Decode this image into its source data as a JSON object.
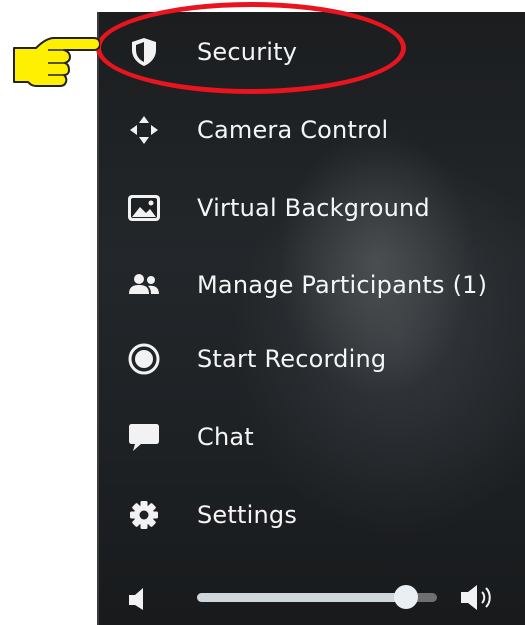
{
  "menu": {
    "items": [
      {
        "label": "Security",
        "icon": "shield-icon"
      },
      {
        "label": "Camera Control",
        "icon": "camera-control-icon"
      },
      {
        "label": "Virtual Background",
        "icon": "virtual-background-icon"
      },
      {
        "label": "Manage Participants (1)",
        "icon": "participants-icon"
      },
      {
        "label": "Start Recording",
        "icon": "record-icon"
      },
      {
        "label": "Chat",
        "icon": "chat-icon"
      },
      {
        "label": "Settings",
        "icon": "gear-icon"
      }
    ]
  },
  "volume": {
    "level": 0.87,
    "low_icon": "volume-low-icon",
    "high_icon": "volume-high-icon"
  },
  "annotation": {
    "highlight_color": "#e8141e",
    "pointer_color": "#ffef00",
    "pointer_icon": "pointing-hand-icon"
  },
  "colors": {
    "panel_background": "#1e2124",
    "menu_text": "#f5f5f5",
    "slider_fill": "#cfd6dc",
    "slider_track": "#6f6f6f"
  }
}
